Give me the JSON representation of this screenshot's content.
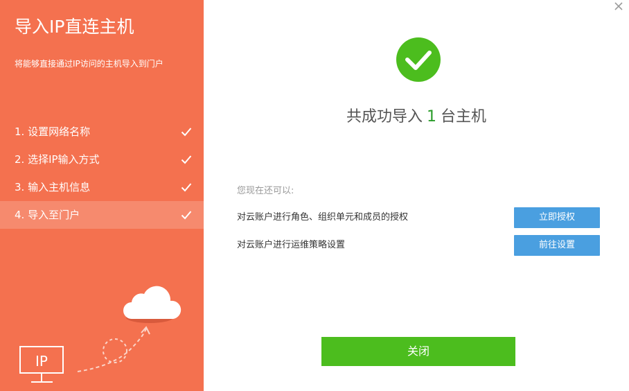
{
  "sidebar": {
    "title": "导入IP直连主机",
    "description": "将能够直接通过IP访问的主机导入到门户",
    "steps": [
      {
        "label": "1. 设置网络名称",
        "done": true
      },
      {
        "label": "2. 选择IP输入方式",
        "done": true
      },
      {
        "label": "3. 输入主机信息",
        "done": true
      },
      {
        "label": "4. 导入至门户",
        "done": true,
        "active": true
      }
    ],
    "illustration_label": "IP"
  },
  "result": {
    "prefix": "共成功导入",
    "count": "1",
    "suffix": "台主机"
  },
  "next": {
    "hint": "您现在还可以:",
    "actions": [
      {
        "text": "对云账户进行角色、组织单元和成员的授权",
        "button": "立即授权"
      },
      {
        "text": "对云账户进行运维策略设置",
        "button": "前往设置"
      }
    ]
  },
  "footer": {
    "close_label": "关闭"
  },
  "colors": {
    "sidebar_bg": "#f4714f",
    "success_green": "#4cbd1e",
    "action_blue": "#4a9fe0"
  }
}
